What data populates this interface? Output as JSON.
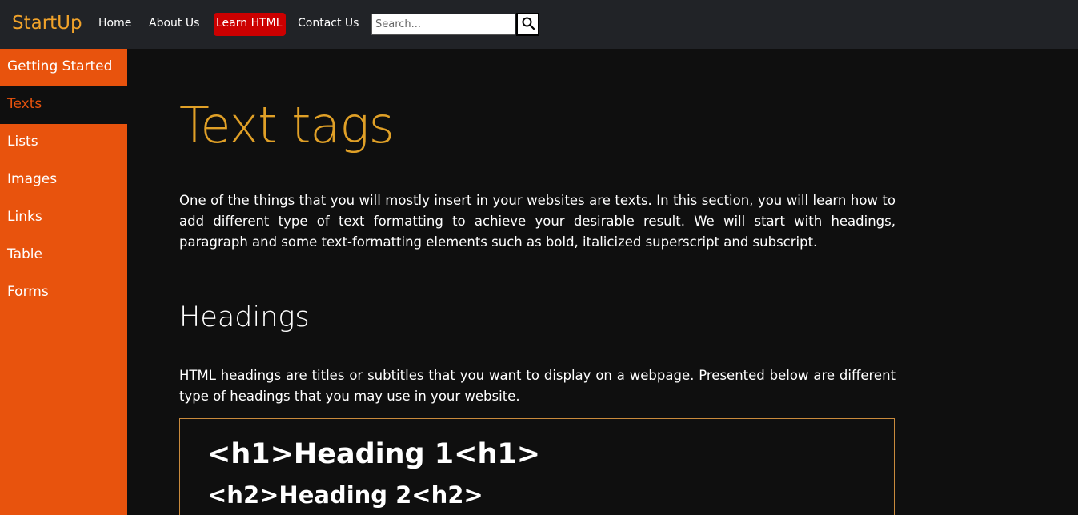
{
  "header": {
    "brand": "StartUp",
    "nav": {
      "home": "Home",
      "about": "About Us",
      "learn": "Learn HTML",
      "contact": "Contact Us"
    },
    "search": {
      "placeholder": "Search...",
      "value": "",
      "button_icon": "search-icon"
    }
  },
  "sidebar": {
    "items": [
      {
        "label": "Getting Started",
        "active": false
      },
      {
        "label": "Texts",
        "active": true
      },
      {
        "label": "Lists",
        "active": false
      },
      {
        "label": "Images",
        "active": false
      },
      {
        "label": "Links",
        "active": false
      },
      {
        "label": "Table",
        "active": false
      },
      {
        "label": "Forms",
        "active": false
      }
    ]
  },
  "main": {
    "title": "Text tags",
    "intro": "One of the things that you will mostly insert in your websites are texts. In this section, you will learn how to add different type of text formatting to achieve your desirable result. We will start with headings, paragraph and some text-formatting elements such as bold, italicized superscript and subscript.",
    "section": {
      "heading": "Headings",
      "paragraph": "HTML headings are titles or subtitles that you want to display on a webpage. Presented below are different type of headings that you may use in your website.",
      "examples": [
        "<h1>Heading 1<h1>",
        "<h2>Heading 2<h2>"
      ]
    }
  },
  "colors": {
    "topbar": "#212327",
    "brand": "#f0a22a",
    "sidebar": "#e8530d",
    "learn_button": "#cc0000",
    "background": "#0f0f0f",
    "title": "#e0a027",
    "code_border": "#c98a3c"
  }
}
